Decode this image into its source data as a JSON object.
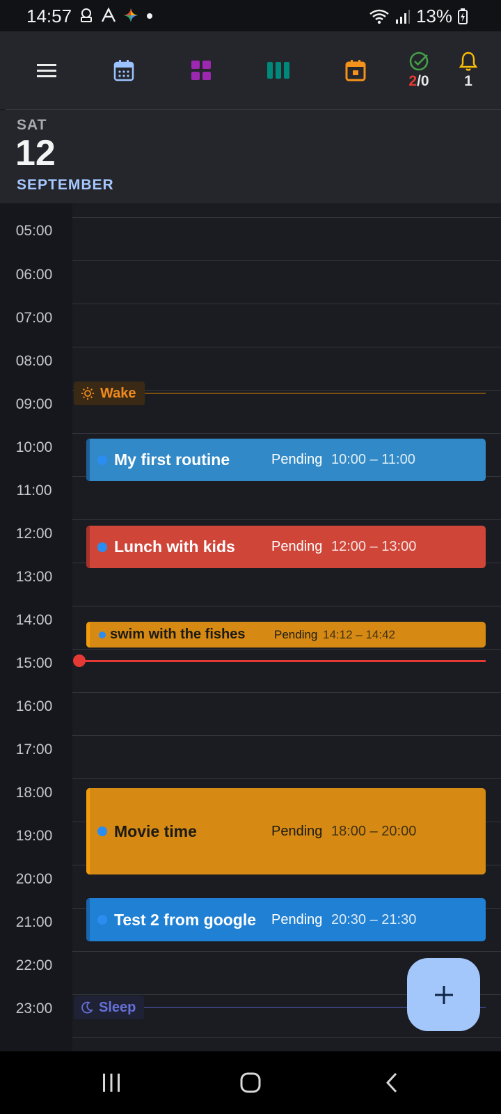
{
  "status_bar": {
    "time": "14:57",
    "battery": "13%",
    "icons": [
      "notification-icon",
      "arc-icon",
      "gemini-icon",
      "dot-icon",
      "wifi-icon",
      "signal-icon",
      "battery-charging-icon"
    ]
  },
  "toolbar": {
    "items": [
      "menu-icon",
      "calendar-day-icon",
      "grid-icon",
      "columns-icon",
      "calendar-event-icon"
    ],
    "tasks_done": "2",
    "tasks_separator": "/",
    "tasks_total": "0",
    "notifications": "1"
  },
  "date_header": {
    "day": "SAT",
    "date": "12",
    "month": "SEPTEMBER"
  },
  "hours": [
    "05:00",
    "06:00",
    "07:00",
    "08:00",
    "09:00",
    "10:00",
    "11:00",
    "12:00",
    "13:00",
    "14:00",
    "15:00",
    "16:00",
    "17:00",
    "18:00",
    "19:00",
    "20:00",
    "21:00",
    "22:00",
    "23:00"
  ],
  "markers": {
    "wake": "Wake",
    "sleep": "Sleep"
  },
  "events": [
    {
      "title": "My first routine",
      "status": "Pending",
      "range": "10:00 – 11:00"
    },
    {
      "title": "Lunch with kids",
      "status": "Pending",
      "range": "12:00 – 13:00"
    },
    {
      "title": "swim with the fishes",
      "status": "Pending",
      "range": "14:12 – 14:42"
    },
    {
      "title": "Movie time",
      "status": "Pending",
      "range": "18:00 – 20:00"
    },
    {
      "title": "Test 2 from google",
      "status": "Pending",
      "range": "20:30 – 21:30"
    }
  ],
  "colors": {
    "accent": "#a3c6fb",
    "now_line": "#e53935",
    "event_blue": "#318ac7",
    "event_red": "#cf4538",
    "event_amber": "#d68a14",
    "wake": "#f08a1e",
    "sleep": "#6670d8"
  }
}
